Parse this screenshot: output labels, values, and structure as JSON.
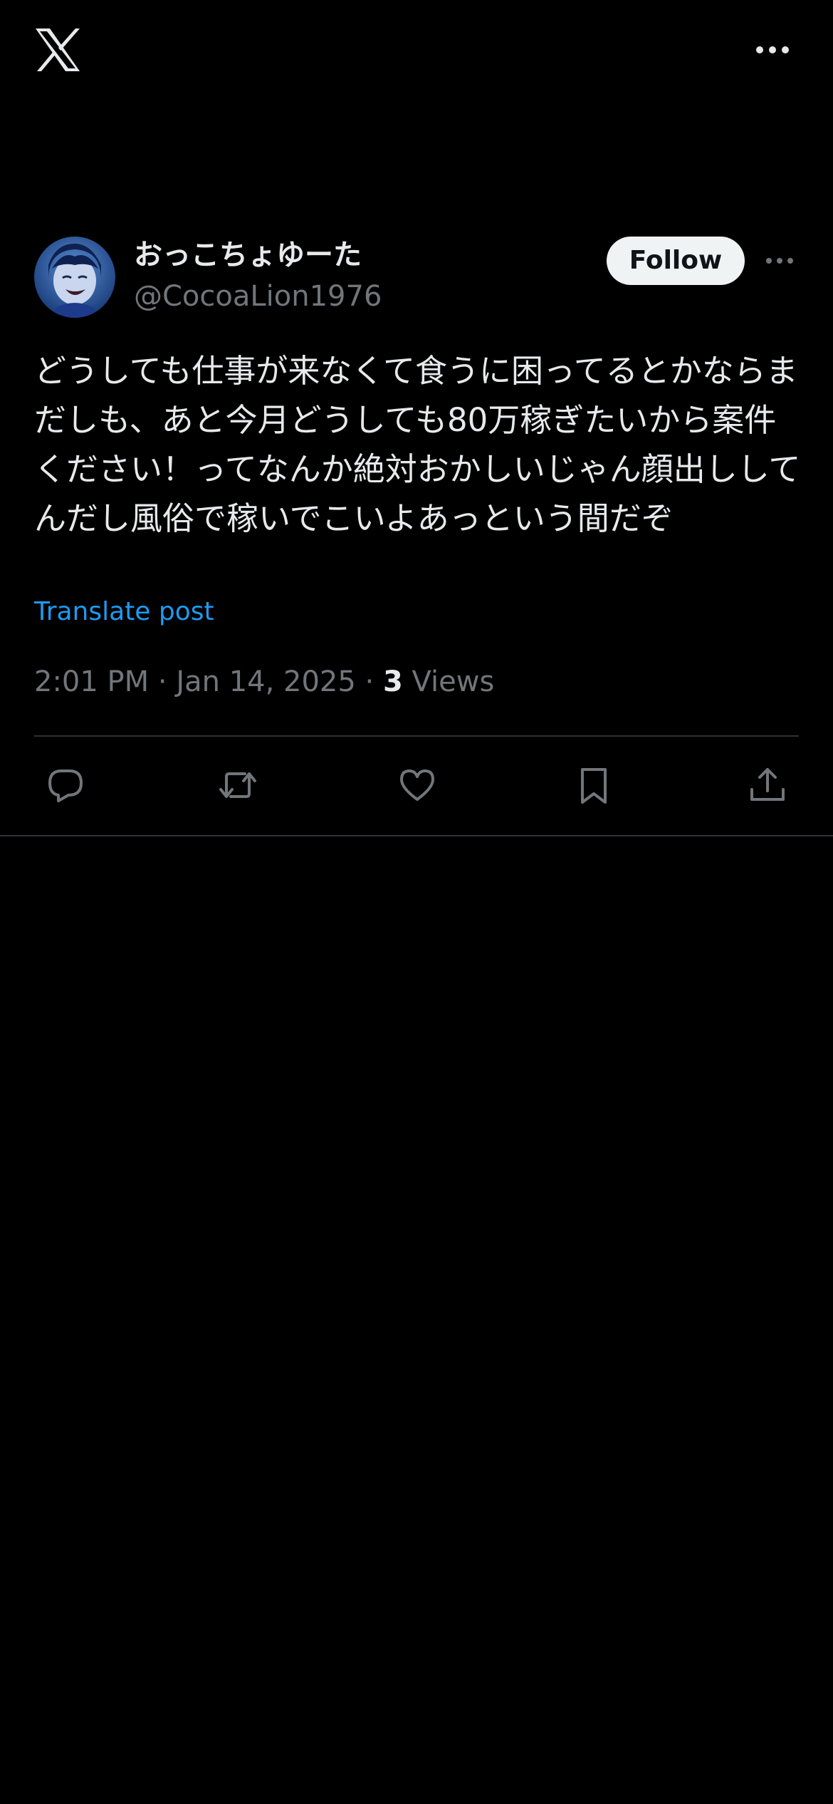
{
  "topbar": {
    "logo_icon": "x-logo-icon",
    "more_icon": "more-horizontal-icon"
  },
  "post": {
    "author": {
      "display_name": "おっこちょゆーた",
      "handle": "@CocoaLion1976",
      "avatar_icon": "avatar-image"
    },
    "follow_label": "Follow",
    "more_icon": "more-horizontal-icon",
    "text": "どうしても仕事が来なくて食うに困ってるとかならまだしも、あと今月どうしても80万稼ぎたいから案件ください！ってなんか絶対おかしいじゃん顔出ししてんだし風俗で稼いでこいよあっという間だぞ",
    "translate_label": "Translate post",
    "time": "2:01 PM",
    "date": "Jan 14, 2025",
    "separator": "·",
    "views_count": "3",
    "views_label": "Views"
  },
  "actions": [
    {
      "name": "reply",
      "icon": "reply-icon"
    },
    {
      "name": "repost",
      "icon": "repost-icon"
    },
    {
      "name": "like",
      "icon": "heart-icon"
    },
    {
      "name": "bookmark",
      "icon": "bookmark-icon"
    },
    {
      "name": "share",
      "icon": "share-icon"
    }
  ],
  "colors": {
    "background": "#000000",
    "text_primary": "#e7e9ea",
    "text_secondary": "#71767b",
    "accent": "#1d9bf0",
    "divider": "#2f3336",
    "follow_bg": "#eff3f4"
  }
}
